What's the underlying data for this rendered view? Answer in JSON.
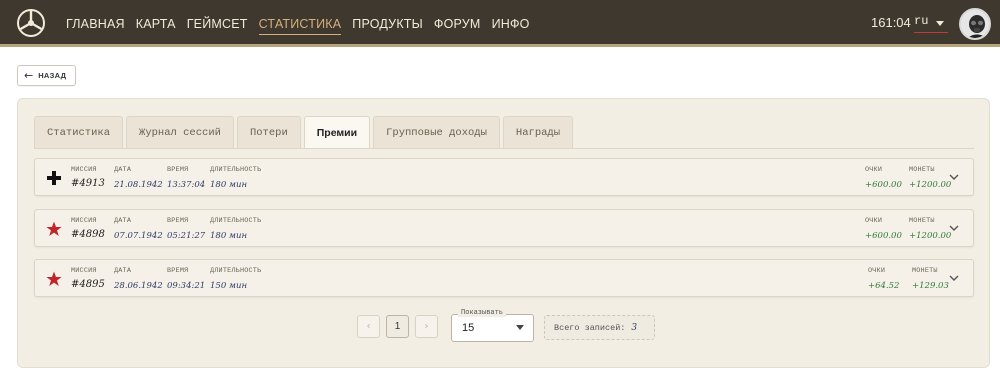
{
  "nav": {
    "items": [
      "ГЛАВНАЯ",
      "КАРТА",
      "ГЕЙМСЕТ",
      "СТАТИСТИКА",
      "ПРОДУКТЫ",
      "ФОРУМ",
      "ИНФО"
    ],
    "active": "СТАТИСТИКА",
    "clock": "161:04",
    "lang": "ru"
  },
  "back": {
    "label": "НАЗАД"
  },
  "tabs": [
    "Статистика",
    "Журнал сессий",
    "Потери",
    "Премии",
    "Групповые доходы",
    "Награды"
  ],
  "active_tab": "Премии",
  "columns": {
    "mission": "МИССИЯ",
    "date": "ДАТА",
    "time": "ВРЕМЯ",
    "duration": "ДЛИТЕЛЬНОСТЬ",
    "points": "ОЧКИ",
    "coins": "МОНЕТЫ"
  },
  "rows": [
    {
      "faction": "german-cross",
      "mission": "#4913",
      "date": "21.08.1942",
      "time": "13:37:04",
      "duration": "180 мин",
      "points": "+600.00",
      "coins": "+1200.00"
    },
    {
      "faction": "soviet-star",
      "mission": "#4898",
      "date": "07.07.1942",
      "time": "05:21:27",
      "duration": "180 мин",
      "points": "+600.00",
      "coins": "+1200.00"
    },
    {
      "faction": "soviet-star",
      "mission": "#4895",
      "date": "28.06.1942",
      "time": "09:34:21",
      "duration": "150 мин",
      "points": "+64.52",
      "coins": "+129.03"
    }
  ],
  "pagination": {
    "prev": "‹",
    "page": "1",
    "next": "›",
    "show_label": "Показывать",
    "show_value": "15",
    "total_label": "Всего записей:",
    "total_value": "3"
  },
  "colors": {
    "topbar": "#3f382e",
    "accent": "#d3b07e",
    "green": "#2f7a3a",
    "star": "#c0262b"
  }
}
